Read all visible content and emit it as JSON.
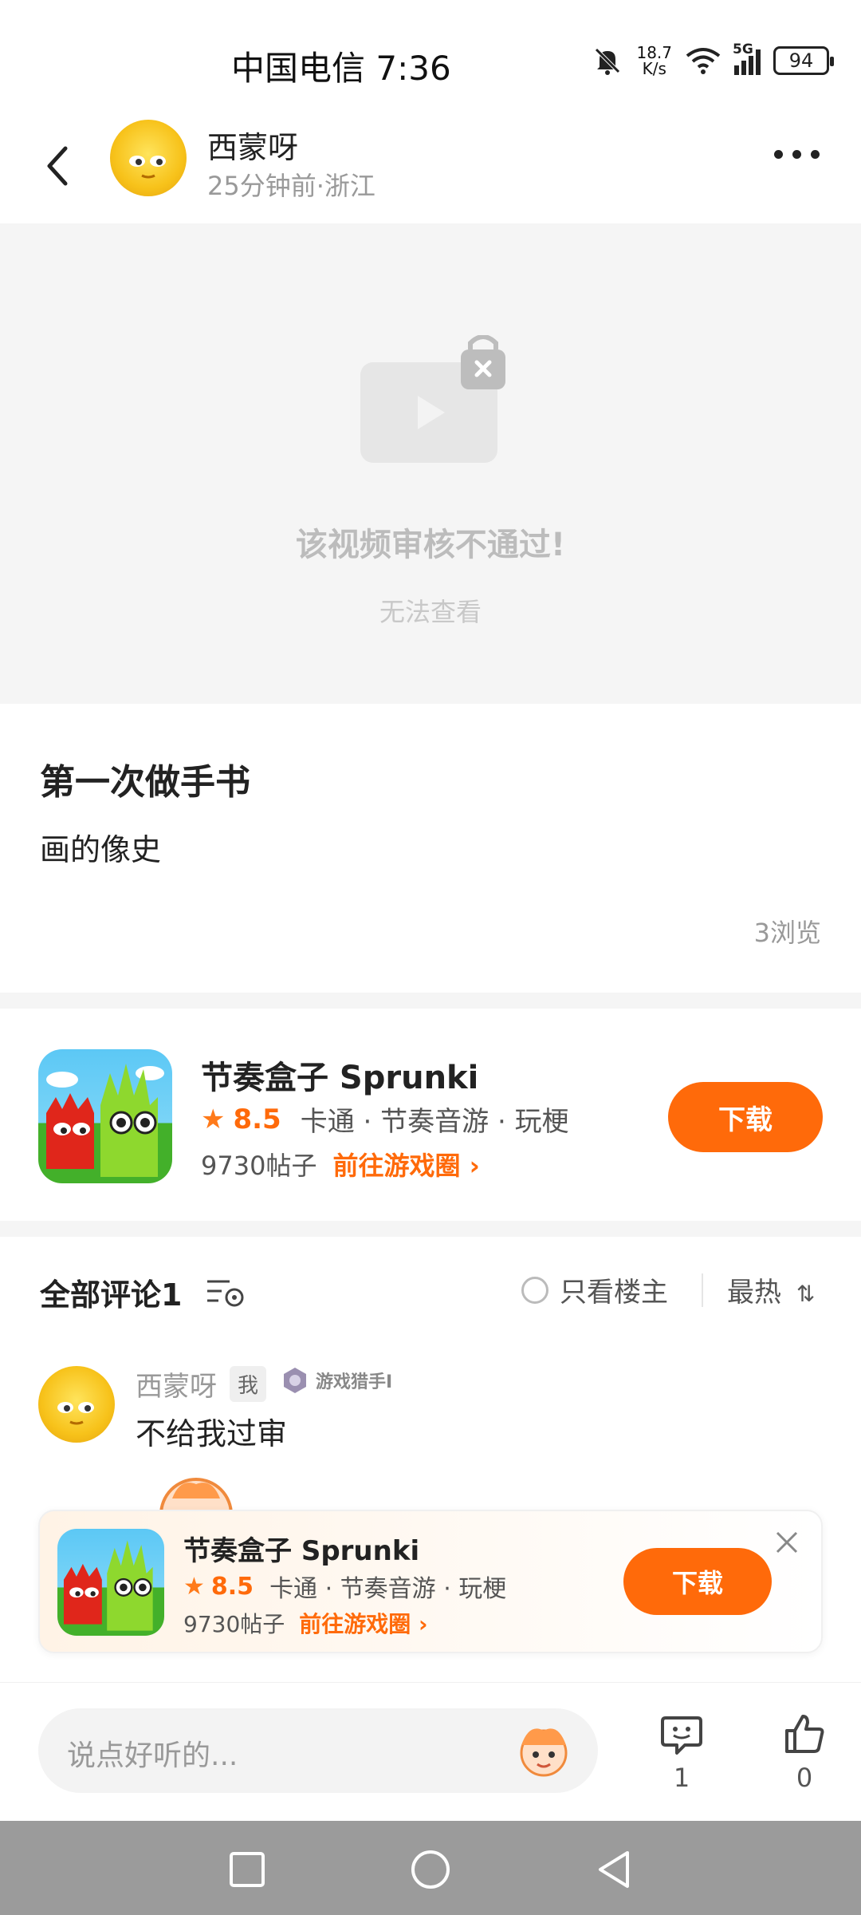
{
  "status_bar": {
    "carrier_time": "中国电信 7:36",
    "net_speed_value": "18.7",
    "net_speed_unit": "K/s",
    "signal": "5G",
    "battery": "94",
    "icons": [
      "mute-bell-icon",
      "wifi-icon",
      "signal-icon",
      "battery-icon"
    ]
  },
  "header": {
    "author_name": "西蒙呀",
    "meta": "25分钟前·浙江",
    "icons": [
      "back-arrow-icon",
      "more-dots-icon"
    ]
  },
  "video": {
    "message": "该视频审核不通过!",
    "sub_message": "无法查看",
    "icon": "locked-video-icon"
  },
  "post": {
    "title": "第一次做手书",
    "body": "画的像史",
    "views": "3浏览"
  },
  "app_card": {
    "name": "节奏盒子 Sprunki",
    "rating": "8.5",
    "tags": "卡通 · 节奏音游 · 玩梗",
    "posts": "9730帖子",
    "goto_label": "前往游戏圈",
    "download_label": "下载"
  },
  "comments": {
    "title": "全部评论1",
    "only_op_label": "只看楼主",
    "sort_label": "最热",
    "items": [
      {
        "name": "西蒙呀",
        "tag": "我",
        "badge": "游戏猎手I",
        "text": "不给我过审"
      }
    ]
  },
  "floating_card": {
    "name": "节奏盒子 Sprunki",
    "rating": "8.5",
    "tags": "卡通 · 节奏音游 · 玩梗",
    "posts": "9730帖子",
    "goto_label": "前往游戏圈",
    "download_label": "下载"
  },
  "bottom_bar": {
    "placeholder": "说点好听的...",
    "comment_count": "1",
    "like_count": "0"
  },
  "colors": {
    "accent": "#ff6a0a",
    "nav_bar": "#9b9b9b"
  }
}
